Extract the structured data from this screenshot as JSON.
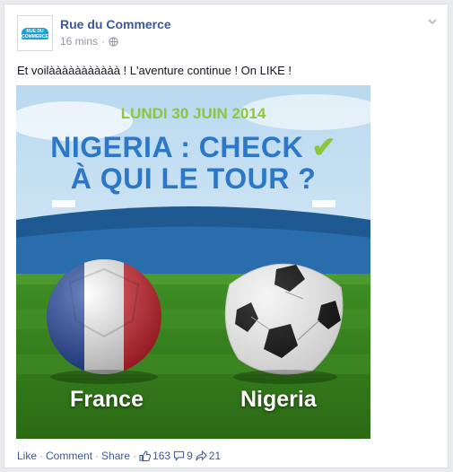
{
  "post": {
    "author": "Rue du Commerce",
    "avatar_text": "RUE DU COMMERCE",
    "time": "16 mins",
    "separator": "·",
    "text": "Et voilààààààààààà ! L'aventure continue ! On LIKE !"
  },
  "image": {
    "date": "LUNDI 30 JUIN 2014",
    "headline_line1": "NIGERIA : CHECK",
    "checkmark": "✔",
    "headline_line2": "À QUI LE TOUR ?",
    "team_left": "France",
    "team_right": "Nigeria"
  },
  "actions": {
    "like": "Like",
    "comment": "Comment",
    "share": "Share",
    "dot": "·",
    "likes_count": "163",
    "comments_count": "9",
    "shares_count": "21"
  },
  "colors": {
    "link": "#3b5998",
    "meta": "#9197a3",
    "headline": "#2c77c7",
    "accent_green": "#8cc63f"
  },
  "icons": [
    "globe-icon",
    "chevron-down-icon",
    "thumbs-up-icon",
    "comment-icon",
    "share-icon"
  ]
}
